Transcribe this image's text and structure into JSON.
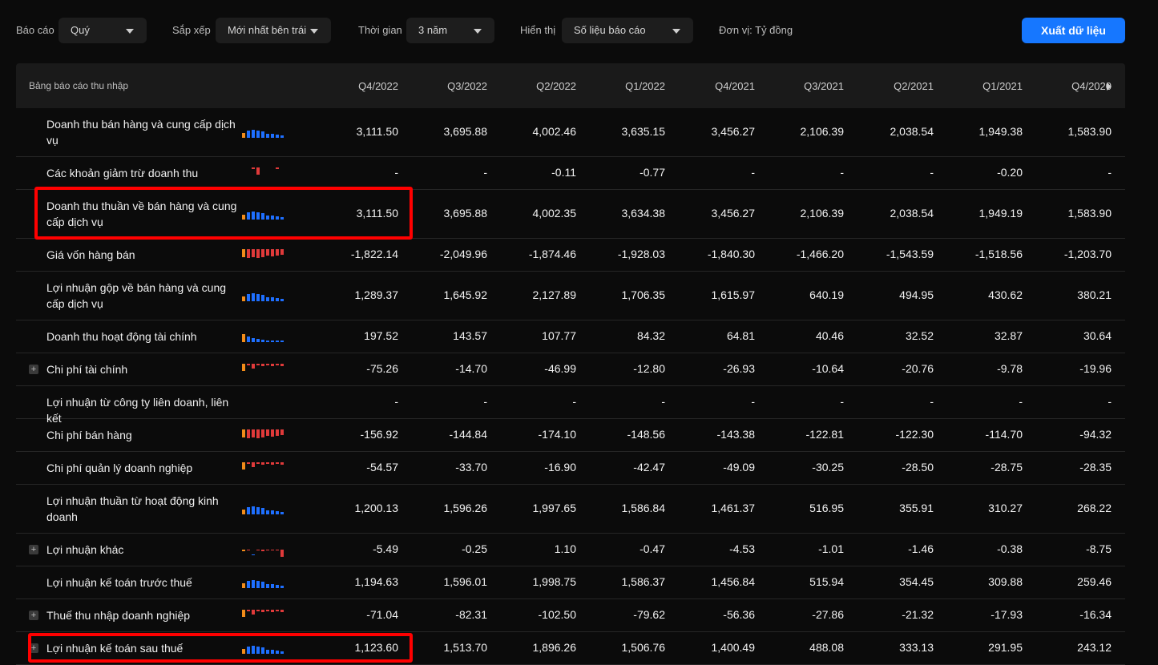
{
  "toolbar": {
    "report_label": "Báo cáo",
    "report_value": "Quý",
    "sort_label": "Sắp xếp",
    "sort_value": "Mới nhất bên trái",
    "time_label": "Thời gian",
    "time_value": "3 năm",
    "display_label": "Hiển thị",
    "display_value": "Số liệu báo cáo",
    "unit": "Đơn vị: Tỷ đồng",
    "export_label": "Xuất dữ liệu"
  },
  "table": {
    "title": "Bảng báo cáo thu nhập",
    "columns": [
      "Q4/2022",
      "Q3/2022",
      "Q2/2022",
      "Q1/2022",
      "Q4/2021",
      "Q3/2021",
      "Q2/2021",
      "Q1/2021",
      "Q4/2020"
    ],
    "rows": [
      {
        "label": "Doanh thu bán hàng và cung cấp dịch vụ",
        "expand": false,
        "spark": "up",
        "values": [
          "3,111.50",
          "3,695.88",
          "4,002.46",
          "3,635.15",
          "3,456.27",
          "2,106.39",
          "2,038.54",
          "1,949.38",
          "1,583.90"
        ]
      },
      {
        "label": "Các khoản giảm trừ doanh thu",
        "expand": false,
        "spark": "single",
        "values": [
          "-",
          "-",
          "-0.11",
          "-0.77",
          "-",
          "-",
          "-",
          "-0.20",
          "-"
        ]
      },
      {
        "label": "Doanh thu thuần về bán hàng và cung cấp dịch vụ",
        "expand": false,
        "spark": "up",
        "values": [
          "3,111.50",
          "3,695.88",
          "4,002.35",
          "3,634.38",
          "3,456.27",
          "2,106.39",
          "2,038.54",
          "1,949.19",
          "1,583.90"
        ]
      },
      {
        "label": "Giá vốn hàng bán",
        "expand": false,
        "spark": "neg",
        "values": [
          "-1,822.14",
          "-2,049.96",
          "-1,874.46",
          "-1,928.03",
          "-1,840.30",
          "-1,466.20",
          "-1,543.59",
          "-1,518.56",
          "-1,203.70"
        ]
      },
      {
        "label": "Lợi nhuận gộp về bán hàng và cung cấp dịch vụ",
        "expand": false,
        "spark": "up",
        "values": [
          "1,289.37",
          "1,645.92",
          "2,127.89",
          "1,706.35",
          "1,615.97",
          "640.19",
          "494.95",
          "430.62",
          "380.21"
        ]
      },
      {
        "label": "Doanh thu hoạt động tài chính",
        "expand": false,
        "spark": "down",
        "values": [
          "197.52",
          "143.57",
          "107.77",
          "84.32",
          "64.81",
          "40.46",
          "32.52",
          "32.87",
          "30.64"
        ]
      },
      {
        "label": "Chi phí tài chính",
        "expand": true,
        "spark": "mixneg",
        "values": [
          "-75.26",
          "-14.70",
          "-46.99",
          "-12.80",
          "-26.93",
          "-10.64",
          "-20.76",
          "-9.78",
          "-19.96"
        ]
      },
      {
        "label": "Lợi nhuận từ công ty liên doanh, liên kết",
        "expand": false,
        "spark": "none",
        "values": [
          "-",
          "-",
          "-",
          "-",
          "-",
          "-",
          "-",
          "-",
          "-"
        ]
      },
      {
        "label": "Chi phí bán hàng",
        "expand": false,
        "spark": "neg",
        "values": [
          "-156.92",
          "-144.84",
          "-174.10",
          "-148.56",
          "-143.38",
          "-122.81",
          "-122.30",
          "-114.70",
          "-94.32"
        ]
      },
      {
        "label": "Chi phí quản lý doanh nghiệp",
        "expand": false,
        "spark": "mixneg",
        "values": [
          "-54.57",
          "-33.70",
          "-16.90",
          "-42.47",
          "-49.09",
          "-30.25",
          "-28.50",
          "-28.75",
          "-28.35"
        ]
      },
      {
        "label": "Lợi nhuận thuần từ hoạt động kinh doanh",
        "expand": false,
        "spark": "up",
        "values": [
          "1,200.13",
          "1,596.26",
          "1,997.65",
          "1,586.84",
          "1,461.37",
          "516.95",
          "355.91",
          "310.27",
          "268.22"
        ]
      },
      {
        "label": "Lợi nhuận khác",
        "expand": true,
        "spark": "other",
        "values": [
          "-5.49",
          "-0.25",
          "1.10",
          "-0.47",
          "-4.53",
          "-1.01",
          "-1.46",
          "-0.38",
          "-8.75"
        ]
      },
      {
        "label": "Lợi nhuận kế toán trước thuế",
        "expand": false,
        "spark": "up",
        "values": [
          "1,194.63",
          "1,596.01",
          "1,998.75",
          "1,586.37",
          "1,456.84",
          "515.94",
          "354.45",
          "309.88",
          "259.46"
        ]
      },
      {
        "label": "Thuế thu nhập doanh nghiệp",
        "expand": true,
        "spark": "mixneg",
        "values": [
          "-71.04",
          "-82.31",
          "-102.50",
          "-79.62",
          "-56.36",
          "-27.86",
          "-21.32",
          "-17.93",
          "-16.34"
        ]
      },
      {
        "label": "Lợi nhuận kế toán sau thuế",
        "expand": true,
        "spark": "up",
        "values": [
          "1,123.60",
          "1,513.70",
          "1,896.26",
          "1,506.76",
          "1,400.49",
          "488.08",
          "333.13",
          "291.95",
          "243.12"
        ]
      }
    ]
  },
  "colors": {
    "accent": "#1677ff",
    "positive_bar": "#1e6fff",
    "negative_bar": "#e03a3a",
    "latest_bar": "#f28c1a",
    "highlight": "#ff0000"
  }
}
